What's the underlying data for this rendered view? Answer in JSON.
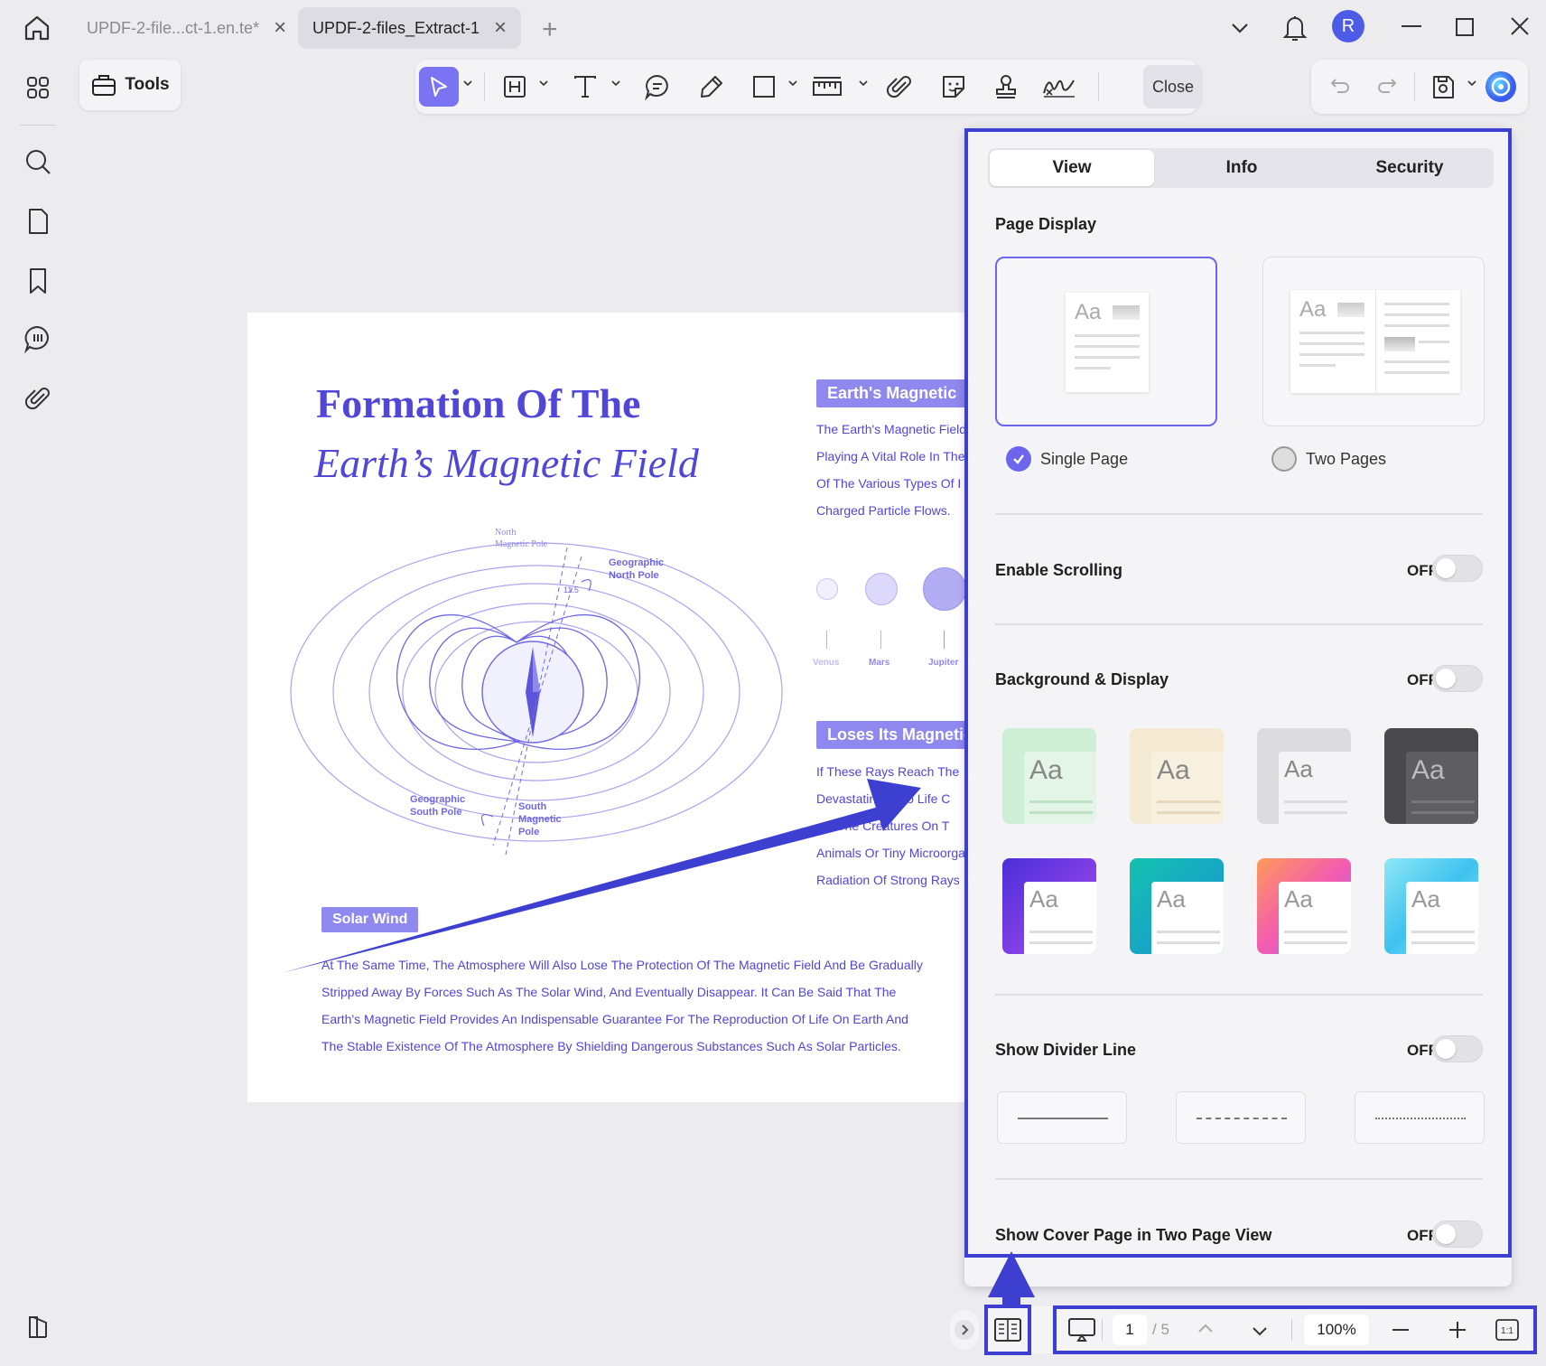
{
  "tabs": [
    {
      "label": "UPDF-2-file...ct-1.en.te*",
      "active": false
    },
    {
      "label": "UPDF-2-files_Extract-1",
      "active": true
    }
  ],
  "user": {
    "avatar_letter": "R"
  },
  "toolbar": {
    "tools_label": "Tools",
    "close_label": "Close"
  },
  "document": {
    "title_line1": "Formation Of The",
    "title_line2": "Earth’s Magnetic Field",
    "section1_label": "Earth's Magnetic",
    "section1_lines": [
      "The Earth's Magnetic Field",
      "Playing A Vital Role In The",
      "Of The Various Types Of I",
      "Charged Particle Flows."
    ],
    "planets": [
      "Venus",
      "Mars",
      "Jupiter"
    ],
    "section2_label": "Loses Its Magnetic",
    "section2_lines": [
      "If These Rays Reach The",
      "Devastating ... To Life C",
      "... , The Creatures On T",
      "Animals Or Tiny Microorga",
      "Radiation Of Strong Rays"
    ],
    "diagram_labels": {
      "north_magnetic": [
        "North",
        "Magnetic Pole"
      ],
      "geo_north": [
        "Geographic",
        "North Pole"
      ],
      "angle": "11.5",
      "geo_south": [
        "Geographic",
        "South Pole"
      ],
      "south_magnetic": [
        "South",
        "Magnetic",
        "Pole"
      ]
    },
    "solar_wind_label": "Solar Wind",
    "body_lines": [
      "At The Same Time, The Atmosphere Will Also Lose The Protection Of The Magnetic Field And Be Gradually",
      "Stripped Away By Forces Such As The Solar Wind, And Eventually Disappear. It Can Be Said That The",
      "Earth's Magnetic Field Provides An Indispensable Guarantee For The Reproduction Of Life On Earth And",
      "The Stable Existence Of The Atmosphere By Shielding Dangerous Substances Such As Solar Particles."
    ]
  },
  "panel": {
    "tabs": [
      "View",
      "Info",
      "Security"
    ],
    "active_tab": "View",
    "page_display_heading": "Page Display",
    "single_page_label": "Single Page",
    "two_pages_label": "Two Pages",
    "sample_text": "Aa",
    "enable_scrolling_label": "Enable Scrolling",
    "enable_scrolling_state": "OFF",
    "background_display_label": "Background & Display",
    "background_display_state": "OFF",
    "show_divider_label": "Show Divider Line",
    "show_divider_state": "OFF",
    "show_cover_label": "Show Cover Page in Two Page View",
    "show_cover_state": "OFF",
    "accent_color": "#3d3fd1"
  },
  "bottombar": {
    "current_page": "1",
    "total_pages": "/ 5",
    "zoom": "100%"
  }
}
